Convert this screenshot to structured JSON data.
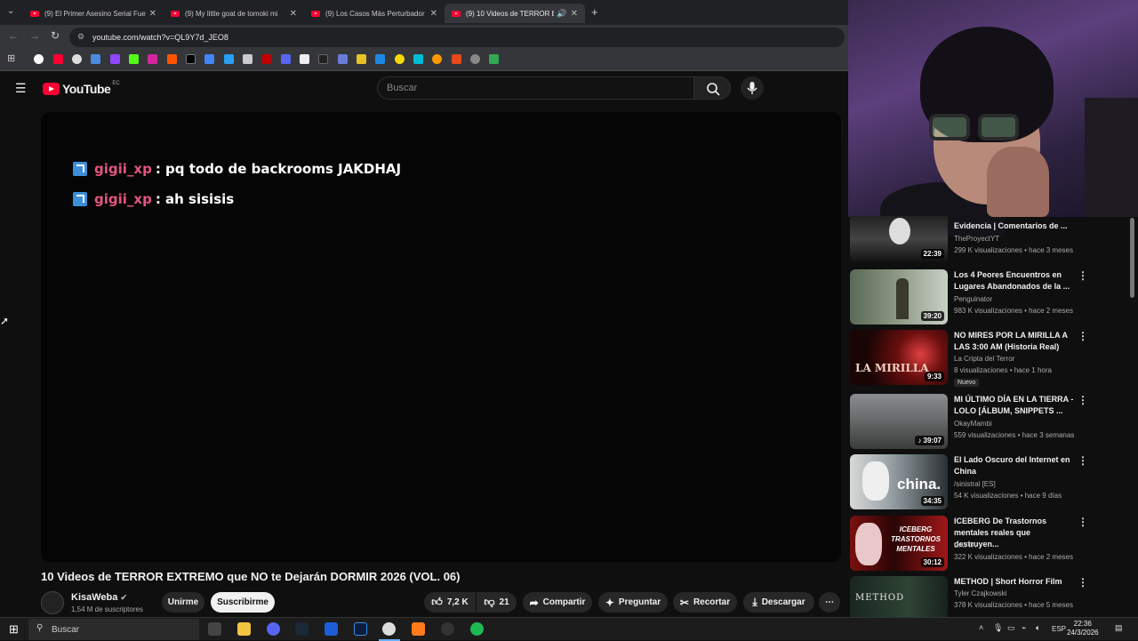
{
  "browser": {
    "tabs": [
      {
        "title": "(9) El Primer Asesino Serial Fue",
        "active": false
      },
      {
        "title": "(9) My little goat de tomoki mi",
        "active": false
      },
      {
        "title": "(9) Los Casos Más Perturbador",
        "active": false
      },
      {
        "title": "(9) 10 Videos de TERROR E",
        "active": true
      }
    ],
    "url": "youtube.com/watch?v=QL9Y7d_JEO8"
  },
  "youtube": {
    "logo": "YouTube",
    "region": "EC",
    "search_placeholder": "Buscar"
  },
  "chat": [
    {
      "user": "gigii_xp",
      "message": ": pq todo de backrooms JAKDHAJ"
    },
    {
      "user": "gigii_xp",
      "message": ": ah sisisis"
    }
  ],
  "video": {
    "title": "10 Videos de TERROR EXTREMO que NO te Dejarán DORMIR 2026 (VOL. 06)",
    "channel": "KisaWeba",
    "subscribers": "1,54 M de suscriptores",
    "join_label": "Unirme",
    "subscribe_label": "Suscribirme",
    "likes": "7,2 K",
    "dislikes": "21",
    "share_label": "Compartir",
    "ask_label": "Preguntar",
    "clip_label": "Recortar",
    "download_label": "Descargar"
  },
  "recommendations": [
    {
      "title": "Evidencia | Comentarios de ...",
      "channel": "TheProyectYT",
      "meta": "299 K visualizaciones • hace 3 meses",
      "duration": "22:39"
    },
    {
      "title": "Los 4 Peores Encuentros en Lugares Abandonados de la ...",
      "channel": "Penguinator",
      "meta": "983 K visualizaciones • hace 2 meses",
      "duration": "39:20"
    },
    {
      "title": "NO MIRES POR LA MIRILLA A LAS 3:00 AM (Historia Real)",
      "channel": "La Cripta del Terror",
      "meta": "8 visualizaciones • hace 1 hora",
      "duration": "9:33",
      "badge": "Nuevo",
      "thumb_text": "LA MIRILLA"
    },
    {
      "title": "MI ÚLTIMO DÍA EN LA TIERRA - LOLO [ÁLBUM, SNIPPETS ...",
      "channel": "OkayMambi",
      "meta": "559 visualizaciones • hace 3 semanas",
      "duration": "♪ 39:07"
    },
    {
      "title": "El Lado Oscuro del Internet en China",
      "channel": "/sinistral [ES]",
      "meta": "54 K visualizaciones • hace 9 días",
      "duration": "34:35",
      "thumb_text": "china."
    },
    {
      "title": "ICEBERG De Trastornos mentales reales que destruyen...",
      "channel": "DATTA",
      "meta": "322 K visualizaciones • hace 2 meses",
      "duration": "30:12",
      "thumb_text": "ICEBERG TRASTORNOS MENTALES"
    },
    {
      "title": "METHOD | Short Horror Film",
      "channel": "Tyler Czajkowski",
      "meta": "378 K visualizaciones • hace 5 meses",
      "duration": "",
      "thumb_text": "METHOD"
    }
  ],
  "taskbar": {
    "search_placeholder": "Buscar",
    "language": "ESP",
    "time": "22:36",
    "date": "24/3/2026"
  },
  "colors": {
    "chat_user": "#e4557f",
    "youtube_red": "#ff0033",
    "background": "#0f0f0f"
  }
}
